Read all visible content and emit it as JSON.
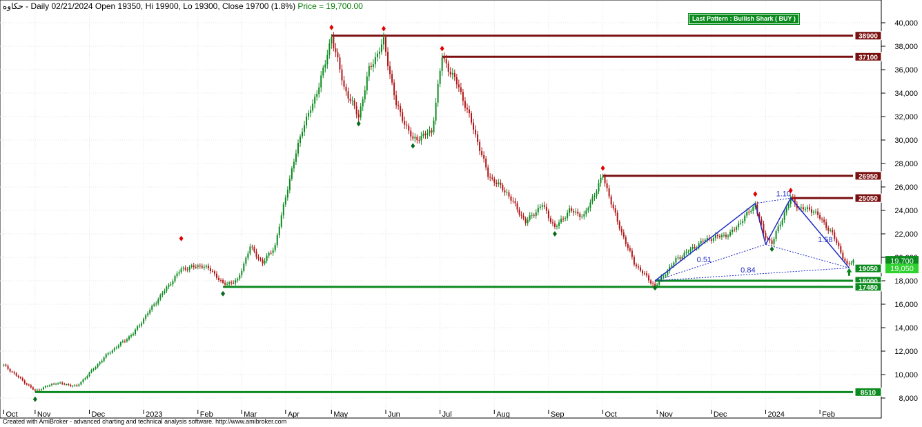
{
  "header": {
    "symbol": "حکاوه",
    "info": " - Daily 02/21/2024 Open 19350, Hi 19900, Lo 19300, Close 19700 (1.8%)",
    "price": " Price = 19,700.00"
  },
  "pattern_label": "Last Pattern : Bullish Shark ( BUY )",
  "footer": "Created with AmiBroker - advanced charting and technical analysis software. http://www.amibroker.com",
  "colors": {
    "resistance": "#7a0f0f",
    "support": "#0b8a1e",
    "pattern": "#1d2bc4",
    "up_bar": "#0b8a1e",
    "down_bar": "#b01515",
    "marker_red": "#e00000",
    "marker_green": "#0b6b1a"
  },
  "chart_data": {
    "type": "candlestick",
    "ylim": [
      7000,
      41000
    ],
    "yticks": [
      8000,
      10000,
      12000,
      14000,
      16000,
      18000,
      20000,
      22000,
      24000,
      26000,
      28000,
      30000,
      32000,
      34000,
      36000,
      38000,
      40000
    ],
    "ytick_labels": [
      "8,000",
      "10,000",
      "12,000",
      "14,000",
      "16,000",
      "18,000",
      "20,000",
      "22,000",
      "24,000",
      "26,000",
      "28,000",
      "30,000",
      "32,000",
      "34,000",
      "36,000",
      "38,000",
      "40,000"
    ],
    "month_labels": [
      "Oct",
      "Nov",
      "Dec",
      "2023",
      "Feb",
      "Mar",
      "Apr",
      "May",
      "Jun",
      "Jul",
      "Aug",
      "Sep",
      "Oct",
      "Nov",
      "Dec",
      "2024",
      "Feb"
    ],
    "month_start_index": [
      0,
      15,
      41,
      67,
      93,
      114,
      135,
      157,
      183,
      209,
      235,
      261,
      287,
      313,
      339,
      365,
      391
    ],
    "bars_count": 408,
    "price_path": [
      [
        0,
        10800
      ],
      [
        15,
        8600
      ],
      [
        25,
        9300
      ],
      [
        35,
        9000
      ],
      [
        50,
        11800
      ],
      [
        62,
        13500
      ],
      [
        72,
        16000
      ],
      [
        85,
        19000
      ],
      [
        95,
        19300
      ],
      [
        100,
        18800
      ],
      [
        105,
        17700
      ],
      [
        112,
        18000
      ],
      [
        118,
        20900
      ],
      [
        124,
        19500
      ],
      [
        130,
        21000
      ],
      [
        136,
        26000
      ],
      [
        143,
        31000
      ],
      [
        148,
        33000
      ],
      [
        154,
        36500
      ],
      [
        157,
        38900
      ],
      [
        163,
        34500
      ],
      [
        170,
        32000
      ],
      [
        175,
        36000
      ],
      [
        182,
        38400
      ],
      [
        188,
        33000
      ],
      [
        196,
        30000
      ],
      [
        205,
        30700
      ],
      [
        210,
        37100
      ],
      [
        218,
        34500
      ],
      [
        225,
        31000
      ],
      [
        232,
        27000
      ],
      [
        241,
        25500
      ],
      [
        250,
        23000
      ],
      [
        258,
        24500
      ],
      [
        264,
        22500
      ],
      [
        271,
        24000
      ],
      [
        278,
        23500
      ],
      [
        287,
        26950
      ],
      [
        294,
        23000
      ],
      [
        302,
        19500
      ],
      [
        312,
        17500
      ],
      [
        322,
        19800
      ],
      [
        336,
        21500
      ],
      [
        348,
        22000
      ],
      [
        360,
        24500
      ],
      [
        364,
        22000
      ],
      [
        368,
        21200
      ],
      [
        377,
        25050
      ],
      [
        381,
        24200
      ],
      [
        388,
        24000
      ],
      [
        397,
        22000
      ],
      [
        404,
        19300
      ],
      [
        407,
        19700
      ]
    ],
    "levels": [
      {
        "value": 38900,
        "label": "38900",
        "kind": "resistance",
        "start": 157
      },
      {
        "value": 37100,
        "label": "37100",
        "kind": "resistance",
        "start": 210
      },
      {
        "value": 26950,
        "label": "26950",
        "kind": "resistance",
        "start": 287
      },
      {
        "value": 25050,
        "label": "25050",
        "kind": "resistance",
        "start": 377
      },
      {
        "value": 18000,
        "label": "18000",
        "kind": "support",
        "start": 312
      },
      {
        "value": 17480,
        "label": "17480",
        "kind": "support",
        "start": 105
      },
      {
        "value": 8510,
        "label": "8510",
        "kind": "support",
        "start": 15
      }
    ],
    "target_label": {
      "value": 19050,
      "label": "19050"
    },
    "price_labels": [
      {
        "value": 19700,
        "label": "19,700",
        "color": "#0b8a1e"
      },
      {
        "value": 19050,
        "label": "19,050",
        "color": "#2fd12f"
      }
    ],
    "harmonic": {
      "points": [
        [
          312,
          18000
        ],
        [
          360,
          24600
        ],
        [
          365,
          21100
        ],
        [
          377,
          25050
        ],
        [
          405,
          19100
        ]
      ],
      "ratios": [
        {
          "label": "0.51",
          "index": 332,
          "value": 19600
        },
        {
          "label": "1.10",
          "index": 370,
          "value": 25200
        },
        {
          "label": "1.58",
          "index": 390,
          "value": 21300
        },
        {
          "label": "0.84",
          "index": 353,
          "value": 18700
        }
      ]
    },
    "red_markers": [
      [
        85,
        21600
      ],
      [
        157,
        39600
      ],
      [
        182,
        39500
      ],
      [
        210,
        37800
      ],
      [
        287,
        27600
      ],
      [
        360,
        25400
      ],
      [
        377,
        25700
      ]
    ],
    "green_markers": [
      [
        15,
        7900
      ],
      [
        105,
        16900
      ],
      [
        170,
        31400
      ],
      [
        196,
        29500
      ],
      [
        264,
        22000
      ],
      [
        312,
        17400
      ],
      [
        368,
        20700
      ]
    ],
    "buy_arrow": {
      "index": 405,
      "value": 18600
    }
  }
}
